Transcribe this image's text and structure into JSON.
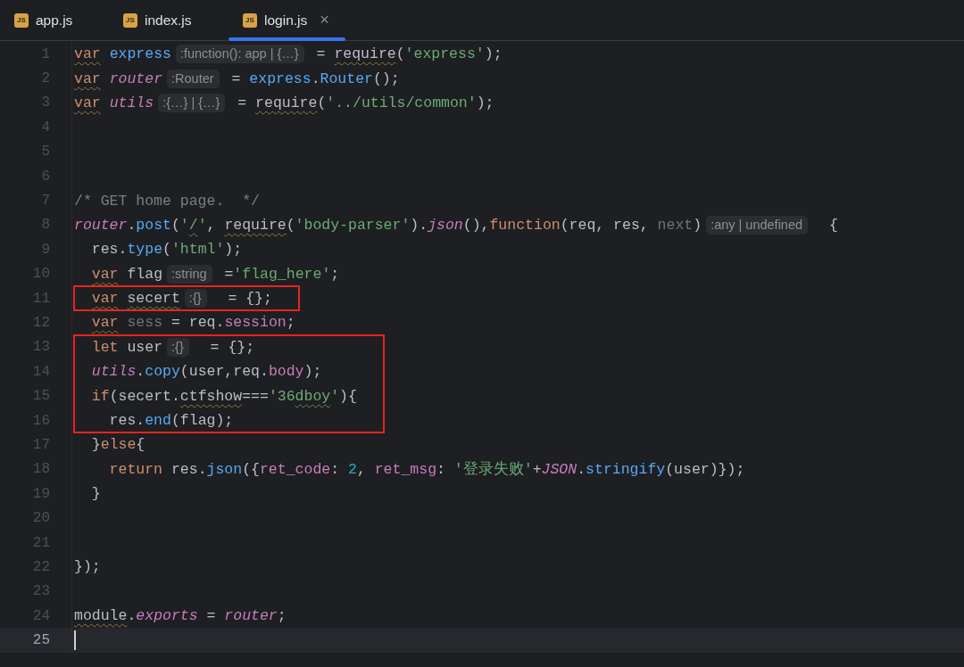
{
  "tabs": [
    {
      "label": "app.js",
      "icon_label": "JS",
      "selected": false
    },
    {
      "label": "index.js",
      "icon_label": "JS",
      "selected": false
    },
    {
      "label": "login.js",
      "icon_label": "JS",
      "selected": true,
      "close_glyph": "×"
    }
  ],
  "editor": {
    "blocks": [
      {
        "boxed": false,
        "lines": [
          {
            "number": "1",
            "current": false,
            "tokens": [
              {
                "kind": "kw",
                "text": "var",
                "warning": true
              },
              {
                "kind": "ident",
                "text": " express"
              },
              {
                "kind": "hint",
                "text": ":function(): app | {…}"
              },
              {
                "kind": "plain",
                "text": " = "
              },
              {
                "kind": "plain",
                "text": "require",
                "warning": true
              },
              {
                "kind": "plain",
                "text": "("
              },
              {
                "kind": "str",
                "text": "'express'"
              },
              {
                "kind": "plain",
                "text": ");"
              }
            ]
          },
          {
            "number": "2",
            "current": false,
            "tokens": [
              {
                "kind": "kw",
                "text": "var",
                "warning": true
              },
              {
                "kind": "italic",
                "text": " router"
              },
              {
                "kind": "hint",
                "text": ":Router"
              },
              {
                "kind": "plain",
                "text": " = "
              },
              {
                "kind": "ident",
                "text": "express"
              },
              {
                "kind": "plain",
                "text": "."
              },
              {
                "kind": "fn",
                "text": "Router"
              },
              {
                "kind": "plain",
                "text": "();"
              }
            ]
          },
          {
            "number": "3",
            "current": false,
            "tokens": [
              {
                "kind": "kw",
                "text": "var",
                "warning": true
              },
              {
                "kind": "italic",
                "text": " utils"
              },
              {
                "kind": "hint",
                "text": ":{…} | {…}"
              },
              {
                "kind": "plain",
                "text": " = "
              },
              {
                "kind": "plain",
                "text": "require",
                "warning": true
              },
              {
                "kind": "plain",
                "text": "("
              },
              {
                "kind": "str",
                "text": "'../utils/common'"
              },
              {
                "kind": "plain",
                "text": ");"
              }
            ]
          },
          {
            "number": "4",
            "current": false
          },
          {
            "number": "5",
            "current": false
          },
          {
            "number": "6",
            "current": false
          },
          {
            "number": "7",
            "current": false,
            "tokens": [
              {
                "kind": "comment",
                "text": "/* GET home page.  */"
              }
            ]
          },
          {
            "number": "8",
            "current": false,
            "tokens": [
              {
                "kind": "italic",
                "text": "router"
              },
              {
                "kind": "plain",
                "text": "."
              },
              {
                "kind": "fn",
                "text": "post"
              },
              {
                "kind": "plain",
                "text": "("
              },
              {
                "kind": "str",
                "text": "'"
              },
              {
                "kind": "str",
                "text": "/",
                "typo": true
              },
              {
                "kind": "str",
                "text": "'"
              },
              {
                "kind": "plain",
                "text": ", "
              },
              {
                "kind": "plain",
                "text": "require",
                "warning": true
              },
              {
                "kind": "plain",
                "text": "("
              },
              {
                "kind": "str",
                "text": "'body-parser'"
              },
              {
                "kind": "plain",
                "text": ")."
              },
              {
                "kind": "italic",
                "text": "json"
              },
              {
                "kind": "plain",
                "text": "(),"
              },
              {
                "kind": "kw",
                "text": "function"
              },
              {
                "kind": "plain",
                "text": "(req, res, "
              },
              {
                "kind": "muted",
                "text": "next"
              },
              {
                "kind": "plain",
                "text": ")"
              },
              {
                "kind": "hint",
                "text": ":any | undefined"
              },
              {
                "kind": "plain",
                "text": "  {"
              }
            ]
          },
          {
            "number": "9",
            "current": false,
            "tokens": [
              {
                "kind": "plain",
                "text": "  res."
              },
              {
                "kind": "fn",
                "text": "type"
              },
              {
                "kind": "plain",
                "text": "("
              },
              {
                "kind": "str",
                "text": "'html'"
              },
              {
                "kind": "plain",
                "text": ");"
              }
            ]
          },
          {
            "number": "10",
            "current": false,
            "tokens": [
              {
                "kind": "kw",
                "text": "  var",
                "warning": true
              },
              {
                "kind": "plain",
                "text": " flag"
              },
              {
                "kind": "hint",
                "text": ":string"
              },
              {
                "kind": "plain",
                "text": " ="
              },
              {
                "kind": "str",
                "text": "'flag_here'"
              },
              {
                "kind": "plain",
                "text": ";"
              }
            ]
          }
        ]
      },
      {
        "boxed": true,
        "lines": [
          {
            "number": "11",
            "current": false,
            "tokens": [
              {
                "kind": "kw",
                "text": "  var",
                "warning": true
              },
              {
                "kind": "plain",
                "text": " secert",
                "typo": true
              },
              {
                "kind": "hint",
                "text": ":{}"
              },
              {
                "kind": "plain",
                "text": "  = {};"
              }
            ]
          }
        ]
      },
      {
        "boxed": false,
        "lines": [
          {
            "number": "12",
            "current": false,
            "tokens": [
              {
                "kind": "kw",
                "text": "  var",
                "warning": true
              },
              {
                "kind": "muted",
                "text": " sess"
              },
              {
                "kind": "plain",
                "text": " = req."
              },
              {
                "kind": "field",
                "text": "session"
              },
              {
                "kind": "plain",
                "text": ";"
              }
            ]
          }
        ]
      },
      {
        "boxed": true,
        "lines": [
          {
            "number": "13",
            "current": false,
            "tokens": [
              {
                "kind": "kw",
                "text": "  let"
              },
              {
                "kind": "plain",
                "text": " user"
              },
              {
                "kind": "hint",
                "text": ":{}"
              },
              {
                "kind": "plain",
                "text": "  = {};"
              }
            ]
          },
          {
            "number": "14",
            "current": false,
            "tokens": [
              {
                "kind": "italic",
                "text": "  utils"
              },
              {
                "kind": "plain",
                "text": "."
              },
              {
                "kind": "fn",
                "text": "copy"
              },
              {
                "kind": "plain",
                "text": "(user,req."
              },
              {
                "kind": "field",
                "text": "body"
              },
              {
                "kind": "plain",
                "text": ");"
              }
            ]
          },
          {
            "number": "15",
            "current": false,
            "tokens": [
              {
                "kind": "kw",
                "text": "  if"
              },
              {
                "kind": "plain",
                "text": "(secert."
              },
              {
                "kind": "plain",
                "text": "ctfshow",
                "warning": true
              },
              {
                "kind": "plain",
                "text": "==="
              },
              {
                "kind": "str",
                "text": "'36"
              },
              {
                "kind": "str",
                "text": "dboy",
                "typo": true
              },
              {
                "kind": "str",
                "text": "'"
              },
              {
                "kind": "plain",
                "text": "){"
              }
            ]
          },
          {
            "number": "16",
            "current": false,
            "tokens": [
              {
                "kind": "plain",
                "text": "    res."
              },
              {
                "kind": "fn",
                "text": "end"
              },
              {
                "kind": "plain",
                "text": "(flag);"
              }
            ]
          }
        ]
      },
      {
        "boxed": false,
        "lines": [
          {
            "number": "17",
            "current": false,
            "tokens": [
              {
                "kind": "plain",
                "text": "  }"
              },
              {
                "kind": "kw",
                "text": "else"
              },
              {
                "kind": "plain",
                "text": "{"
              }
            ]
          },
          {
            "number": "18",
            "current": false,
            "tokens": [
              {
                "kind": "kw",
                "text": "    return"
              },
              {
                "kind": "plain",
                "text": " res."
              },
              {
                "kind": "fn",
                "text": "json"
              },
              {
                "kind": "plain",
                "text": "({"
              },
              {
                "kind": "field",
                "text": "ret_code"
              },
              {
                "kind": "plain",
                "text": ": "
              },
              {
                "kind": "num",
                "text": "2"
              },
              {
                "kind": "plain",
                "text": ", "
              },
              {
                "kind": "field",
                "text": "ret_msg"
              },
              {
                "kind": "plain",
                "text": ": "
              },
              {
                "kind": "str",
                "text": "'登录失败'"
              },
              {
                "kind": "plain",
                "text": "+"
              },
              {
                "kind": "italic",
                "text": "JSON"
              },
              {
                "kind": "plain",
                "text": "."
              },
              {
                "kind": "fn",
                "text": "stringify"
              },
              {
                "kind": "plain",
                "text": "(user)});"
              }
            ]
          },
          {
            "number": "19",
            "current": false,
            "tokens": [
              {
                "kind": "plain",
                "text": "  }"
              }
            ]
          },
          {
            "number": "20",
            "current": false
          },
          {
            "number": "21",
            "current": false
          },
          {
            "number": "22",
            "current": false,
            "tokens": [
              {
                "kind": "plain",
                "text": "});"
              }
            ]
          },
          {
            "number": "23",
            "current": false
          },
          {
            "number": "24",
            "current": false,
            "tokens": [
              {
                "kind": "plain",
                "text": "module",
                "warning": true
              },
              {
                "kind": "plain",
                "text": "."
              },
              {
                "kind": "italic",
                "text": "exports"
              },
              {
                "kind": "plain",
                "text": " = "
              },
              {
                "kind": "italic",
                "text": "router"
              },
              {
                "kind": "plain",
                "text": ";"
              }
            ]
          },
          {
            "number": "25",
            "current": true,
            "caret": true
          }
        ]
      }
    ]
  }
}
